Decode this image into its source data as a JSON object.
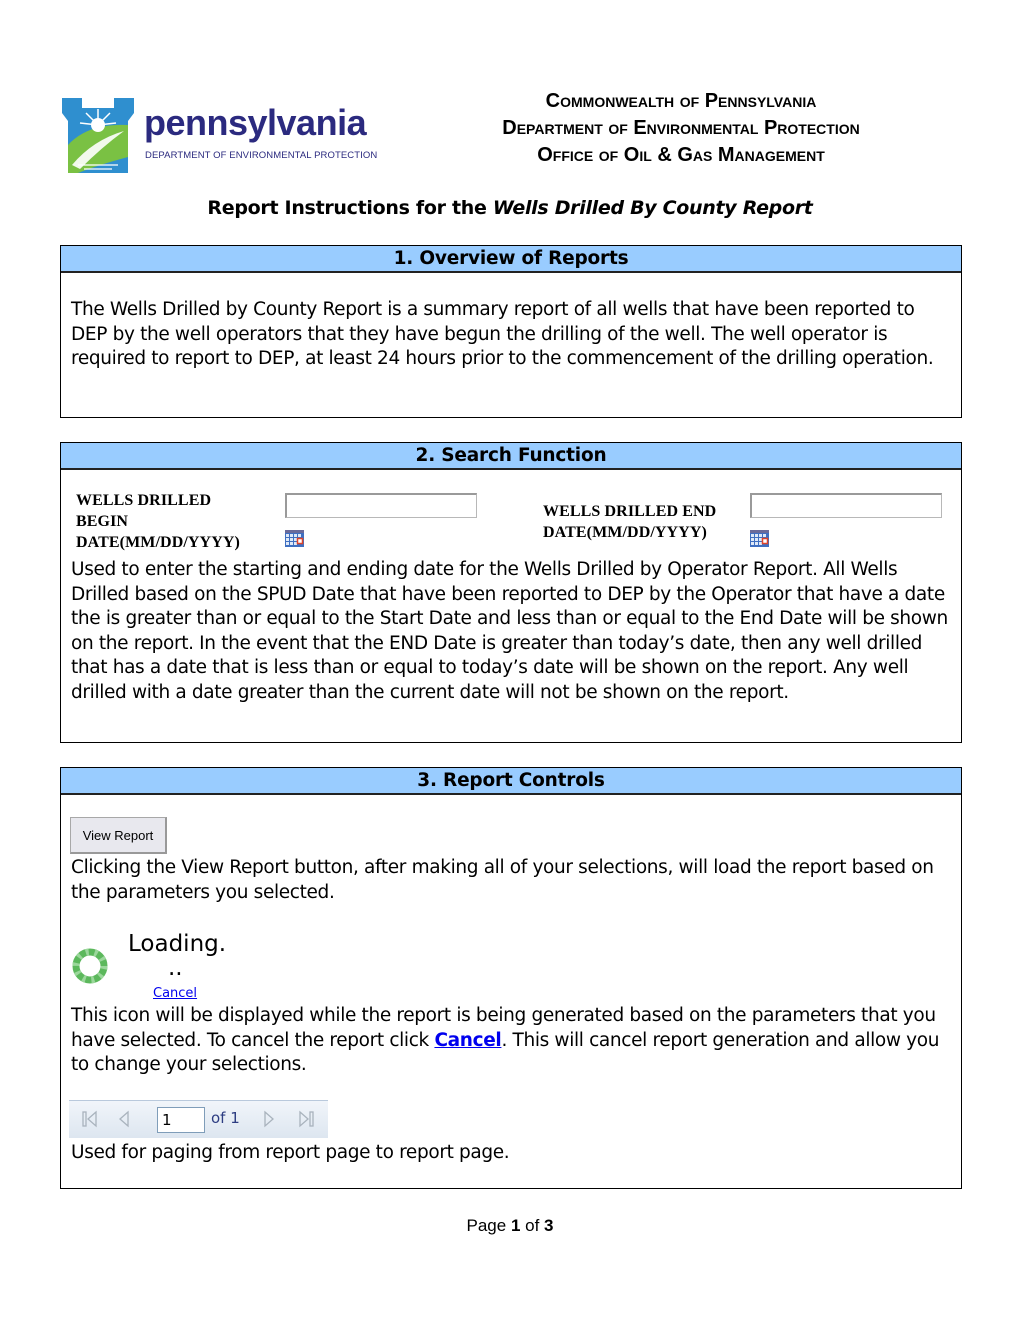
{
  "logo": {
    "wordmark": "pennsylvania",
    "subtitle": "DEPARTMENT OF ENVIRONMENTAL PROTECTION"
  },
  "header": {
    "line1": "Commonwealth of Pennsylvania",
    "line2": "Department of Environmental Protection",
    "line3": "Office of Oil & Gas Management"
  },
  "title": {
    "prefix": "Report Instructions for the ",
    "report_name": "Wells Drilled By County Report"
  },
  "colors": {
    "section_header_bg": "#99ccff",
    "link": "#0000ee",
    "logo_navy": "#2b2a7f"
  },
  "sections": [
    {
      "heading": "1. Overview of Reports",
      "body": "The Wells Drilled by County Report is a summary report of all wells that have been reported to DEP by the well operators that they have begun the drilling of the well. The well operator is required to report to DEP, at least 24 hours prior to the commencement of the drilling operation."
    },
    {
      "heading": "2. Search Function",
      "fields": [
        {
          "label": "WELLS DRILLED BEGIN DATE(MM/DD/YYYY)",
          "value": "",
          "icon": "calendar-icon"
        },
        {
          "label": "WELLS DRILLED END DATE(MM/DD/YYYY)",
          "value": "",
          "icon": "calendar-icon"
        }
      ],
      "body": "Used to enter the starting and ending date for the Wells Drilled by Operator Report. All Wells Drilled based on the SPUD Date that have been reported to DEP by the Operator that have a date the is greater than or equal to the Start Date and less than or equal to the End Date will be shown on the report. In the event that the END Date is greater than today’s date, then any well drilled that has a date that is less than or equal to today’s date will be shown on the report. Any well drilled with a date greater than the current date will not be shown on the report."
    },
    {
      "heading": "3. Report Controls",
      "view_report_label": "View Report",
      "view_report_desc": "Clicking the View Report button, after making all of your selections, will load the report based on the parameters you selected.",
      "loading_text": "Loading.",
      "loading_dots": "..",
      "cancel_label": "Cancel",
      "loading_desc_before": "This icon will be displayed while the report is being generated based on the parameters that you have selected. To cancel the report click ",
      "loading_desc_link": "Cancel",
      "loading_desc_after": ". This will cancel report generation and allow you to change your selections.",
      "pager": {
        "current_page": "1",
        "of_label": "of 1",
        "icons": [
          "first-page-icon",
          "previous-page-icon",
          "next-page-icon",
          "last-page-icon"
        ]
      },
      "pager_desc": "Used for paging from report page to report page."
    }
  ],
  "footer": {
    "page_label": "Page ",
    "page_current": "1",
    "of_label": " of ",
    "page_total": "3"
  }
}
